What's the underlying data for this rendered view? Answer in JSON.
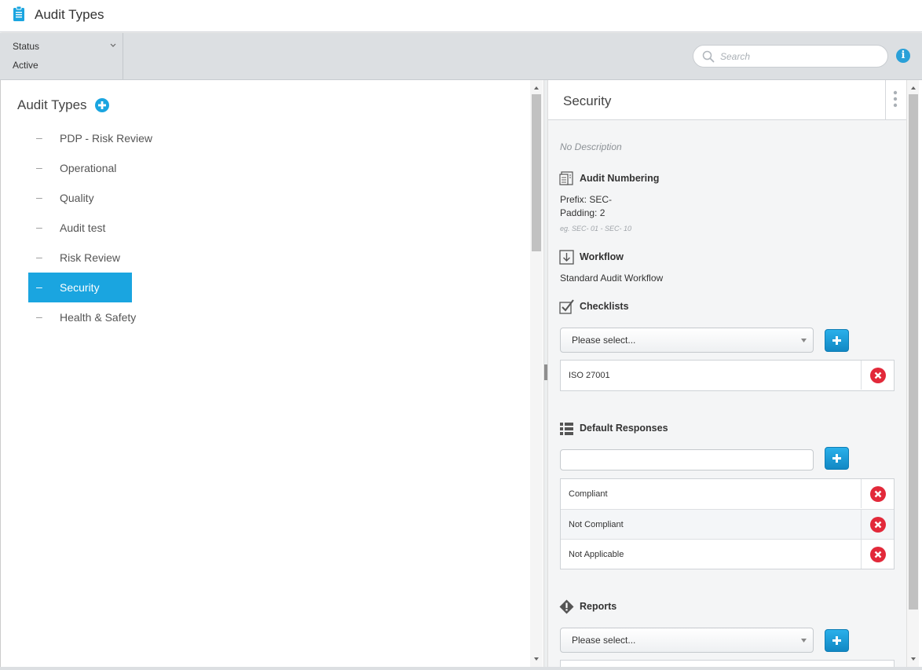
{
  "app": {
    "title": "Audit Types"
  },
  "filters": {
    "status_label": "Status",
    "status_value": "Active",
    "search_placeholder": "Search"
  },
  "tree": {
    "heading": "Audit Types",
    "items": [
      {
        "label": "PDP - Risk Review",
        "selected": false
      },
      {
        "label": "Operational",
        "selected": false
      },
      {
        "label": "Quality",
        "selected": false
      },
      {
        "label": "Audit test",
        "selected": false
      },
      {
        "label": "Risk Review",
        "selected": false
      },
      {
        "label": "Security",
        "selected": true
      },
      {
        "label": "Health & Safety",
        "selected": false
      }
    ]
  },
  "detail": {
    "title": "Security",
    "description": "No Description",
    "numbering": {
      "title": "Audit Numbering",
      "prefix": "Prefix: SEC-",
      "padding": "Padding: 2",
      "example": "eg. SEC- 01 - SEC- 10"
    },
    "workflow": {
      "title": "Workflow",
      "value": "Standard Audit Workflow"
    },
    "checklists": {
      "title": "Checklists",
      "select_value": "Please select...",
      "items": [
        "ISO 27001"
      ]
    },
    "default_responses": {
      "title": "Default Responses",
      "input_value": "",
      "items": [
        "Compliant",
        "Not Compliant",
        "Not Applicable"
      ]
    },
    "reports": {
      "title": "Reports",
      "select_value": "Please select..."
    }
  },
  "colors": {
    "accent": "#1aa5e0",
    "delete": "#e2293a",
    "button": "#1a9fd9"
  }
}
